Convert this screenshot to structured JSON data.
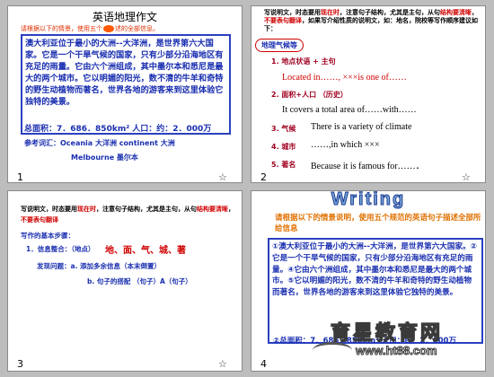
{
  "slides": [
    {
      "number": "1",
      "title": "英语地理作文",
      "instruction_pre": "请根据以下的情景，使用五个",
      "instruction_mid": "的",
      "instruction_post": "述的全部信息。",
      "passage": "澳大利亚位于最小的大洲--大洋洲，是世界第六大国家。它是一个干旱气候的国家，只有少部分沿海地区有充足的雨量。它由六个洲组成，其中墨尔本和悉尼是最大的两个城市。它以明媚的阳光，数不清的牛羊和奇特的野生动植物而著名，世界各地的游客来到这里体验它独特的美景。",
      "stats": "总面积：7．686．850km² 人口：约：2．000万",
      "vocab_line1": "参考词汇：Oceania 大洋洲  continent 大洲",
      "vocab_line2": "Melbourne 墨尔本"
    },
    {
      "number": "2",
      "instruction_a": "写说明文，时态要用",
      "instruction_b": "现在时",
      "instruction_c": "，注意句子结构，尤其是主句，从句",
      "instruction_d": "结构要清晰",
      "instruction_e": "，",
      "instruction_f": "不要表句翻译",
      "instruction_g": "，如果写介绍性质的说明文，如：地名，院校等写作顺序建议如下：",
      "tag": "地理气候等",
      "items": [
        {
          "label": "1. 地点状语 + 主句",
          "example": "Located in……, ×××is one of……"
        },
        {
          "label": "2. 面积+人口 （历史）",
          "example": "It covers a total area of……with……"
        },
        {
          "label": "3. 气候",
          "example": "There is a variety of climate"
        },
        {
          "label": "4. 城市",
          "example": "……,in which ×××"
        },
        {
          "label": "5. 著名",
          "example": "Because it is famous for……．"
        }
      ]
    },
    {
      "number": "3",
      "instruction_a": "写说明文，时态要用",
      "instruction_b": "现在时",
      "instruction_c": "，注意句子结构，尤其是主句，从句",
      "instruction_d": "结构要清晰",
      "instruction_e": "，",
      "instruction_f": "不要表句翻译",
      "steps_title": "写作的基本步骤：",
      "step1_label": "1．信息整合：（地点）",
      "step1_items": "地、面、气、城、著",
      "step2_label": "发现问题：a. 添加多余信息（本末倒置）",
      "step3_label": "b. 句子的搭配 （句子）A（句子）"
    },
    {
      "number": "4",
      "heading": "Writing",
      "instruction": "请根据以下的情景说明，使用五个规范的英语句子描述全部所给信息",
      "passage": "①澳大利亚位于最小的大洲--大洋洲，是世界第六大国家。②它是一个干旱气候的国家，只有少部分沿海地区有充足的雨量。④它由六个洲组成，其中墨尔本和悉尼是最大的两个城市。⑤它以明媚的阳光，数不清的牛羊和奇特的野生动植物而著名，世界各地的游客来到这里体验它独特的美景。",
      "stats": "②总面积：7．686．850km² 人口：约：2．000万"
    }
  ],
  "watermark": {
    "brand": "育星教育网",
    "url": "www.ht88.com"
  },
  "star_glyph": "☆"
}
